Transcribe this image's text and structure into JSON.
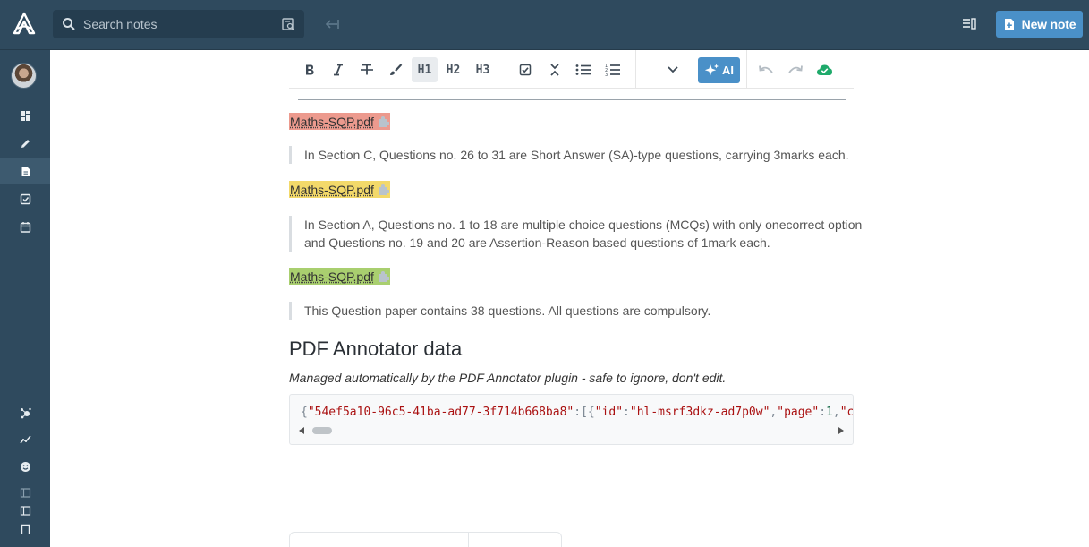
{
  "header": {
    "search_placeholder": "Search notes",
    "new_note_label": "New note"
  },
  "editor": {
    "toolbar": {
      "h1": "H1",
      "h2": "H2",
      "h3": "H3",
      "ai": "AI"
    },
    "annotations": [
      {
        "file": "Maths-SQP.pdf",
        "color": "#ec9a8e",
        "quote": "In Section C, Questions no. 26 to 31 are Short Answer (SA)-type questions, carrying 3marks each."
      },
      {
        "file": "Maths-SQP.pdf",
        "color": "#f3d96a",
        "quote_line1": "In Section A, Questions no. 1 to 18 are multiple choice questions (MCQs) with only onecorrect option",
        "quote_line2": "and Questions no. 19 and 20 are Assertion-Reason based questions of 1mark each."
      },
      {
        "file": "Maths-SQP.pdf",
        "color": "#a9cf6f",
        "quote": "This Question paper contains 38 questions. All questions are compulsory."
      }
    ],
    "section_title": "PDF Annotator data",
    "section_note": "Managed automatically by the PDF Annotator plugin - safe to ignore, don't edit.",
    "code": {
      "brace": "{",
      "key1": "\"54ef5a10-96c5-41ba-ad77-3f714b668ba8\"",
      "colon1": ":",
      "open": "[{",
      "k_id": "\"id\"",
      "colon2": ":",
      "v_id": "\"hl-msrf3dkz-ad7p0w\"",
      "comma1": ",",
      "k_page": "\"page\"",
      "colon3": ":",
      "v_page": "1",
      "comma2": ",",
      "k_color": "\"colo"
    }
  }
}
